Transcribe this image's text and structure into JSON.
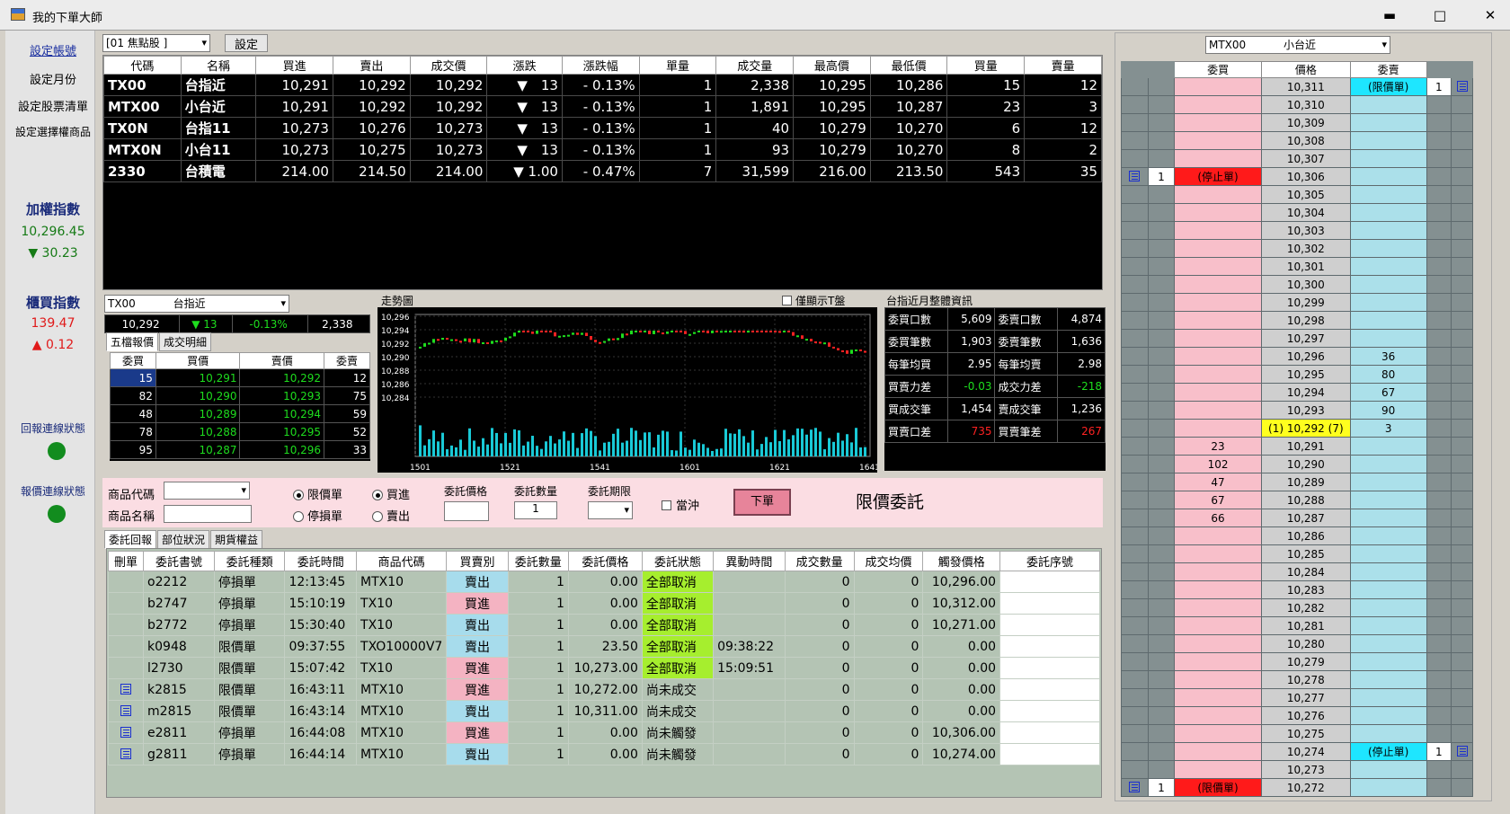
{
  "window": {
    "title": "我的下單大師",
    "minimize": "▬",
    "maximize": "□",
    "close": "✕"
  },
  "nav": {
    "items": [
      "設定帳號",
      "設定月份",
      "設定股票清單",
      "設定選擇權商品"
    ],
    "taiex": {
      "title": "加權指數",
      "value": "10,296.45",
      "change": "▼ 30.23"
    },
    "otc": {
      "title": "櫃買指數",
      "value": "139.47",
      "change": "▲ 0.12"
    },
    "status": [
      "回報連線狀態",
      "報價連線狀態"
    ]
  },
  "quote": {
    "group": "[01 焦點股 ]",
    "settings_btn": "設定",
    "headers": [
      "代碼",
      "名稱",
      "買進",
      "賣出",
      "成交價",
      "漲跌",
      "漲跌幅",
      "單量",
      "成交量",
      "最高價",
      "最低價",
      "買量",
      "賣量"
    ],
    "rows": [
      {
        "code": "TX00",
        "name": "台指近",
        "bid": "10,291",
        "ask": "10,292",
        "last": "10,292",
        "chg": "▼　13",
        "pct": "- 0.13%",
        "qty": "1",
        "vol": "2,338",
        "high": "10,295",
        "low": "10,286",
        "bq": "15",
        "aq": "12"
      },
      {
        "code": "MTX00",
        "name": "小台近",
        "bid": "10,291",
        "ask": "10,292",
        "last": "10,292",
        "chg": "▼　13",
        "pct": "- 0.13%",
        "qty": "1",
        "vol": "1,891",
        "high": "10,295",
        "low": "10,287",
        "bq": "23",
        "aq": "3"
      },
      {
        "code": "TX0N",
        "name": "台指11",
        "bid": "10,273",
        "ask": "10,276",
        "last": "10,273",
        "chg": "▼　13",
        "pct": "- 0.13%",
        "qty": "1",
        "vol": "40",
        "high": "10,279",
        "low": "10,270",
        "bq": "6",
        "aq": "12"
      },
      {
        "code": "MTX0N",
        "name": "小台11",
        "bid": "10,273",
        "ask": "10,275",
        "last": "10,273",
        "chg": "▼　13",
        "pct": "- 0.13%",
        "qty": "1",
        "vol": "93",
        "high": "10,279",
        "low": "10,270",
        "bq": "8",
        "aq": "2"
      },
      {
        "code": "2330",
        "name": "台積電",
        "bid": "214.00",
        "ask": "214.50",
        "last": "214.00",
        "chg": "▼ 1.00",
        "pct": "- 0.47%",
        "qty": "7",
        "vol": "31,599",
        "high": "216.00",
        "low": "213.50",
        "bq": "543",
        "aq": "35"
      }
    ]
  },
  "detail": {
    "symbol": "TX00",
    "name": "台指近",
    "last": "10,292",
    "chg": "▼ 13",
    "pct": "-0.13%",
    "vol": "2,338",
    "tabs": [
      "五檔報價",
      "成交明細"
    ],
    "depth_headers": [
      "委買",
      "買價",
      "賣價",
      "委賣"
    ],
    "depth": [
      [
        "15",
        "10,291",
        "10,292",
        "12"
      ],
      [
        "82",
        "10,290",
        "10,293",
        "75"
      ],
      [
        "48",
        "10,289",
        "10,294",
        "59"
      ],
      [
        "78",
        "10,288",
        "10,295",
        "52"
      ],
      [
        "95",
        "10,287",
        "10,296",
        "33"
      ]
    ]
  },
  "chart": {
    "label": "走勢圖",
    "checkbox": "僅顯示T盤",
    "yticks": [
      "10,296",
      "10,294",
      "10,292",
      "10,290",
      "10,288",
      "10,286",
      "10,284"
    ],
    "xticks": [
      "1501",
      "1521",
      "1541",
      "1601",
      "1621",
      "1641"
    ]
  },
  "stats": {
    "title": "台指近月整體資訊",
    "rows": [
      [
        "委買口數",
        "5,609",
        "委賣口數",
        "4,874"
      ],
      [
        "委買筆數",
        "1,903",
        "委賣筆數",
        "1,636"
      ],
      [
        "每筆均買",
        "2.95",
        "每筆均賣",
        "2.98"
      ],
      [
        "買賣力差",
        "-0.03",
        "成交力差",
        "-218"
      ],
      [
        "買成交筆",
        "1,454",
        "賣成交筆",
        "1,236"
      ],
      [
        "買賣口差",
        "735",
        "買賣筆差",
        "267"
      ]
    ]
  },
  "order": {
    "code_label": "商品代碼",
    "name_label": "商品名稱",
    "limit": "限價單",
    "stop": "停損單",
    "buy": "買進",
    "sell": "賣出",
    "price_label": "委託價格",
    "qty_label": "委託數量",
    "qty_value": "1",
    "tif_label": "委託期限",
    "daytrade": "當沖",
    "submit": "下單",
    "mode_text": "限價委託"
  },
  "orders": {
    "tabs": [
      "委託回報",
      "部位狀況",
      "期貨權益"
    ],
    "headers": [
      "刪單",
      "委託書號",
      "委託種類",
      "委託時間",
      "商品代碼",
      "買賣別",
      "委託數量",
      "委託價格",
      "委託狀態",
      "異動時間",
      "成交數量",
      "成交均價",
      "觸發價格",
      "委託序號"
    ],
    "rows": [
      {
        "del": "",
        "no": "o2212",
        "type": "停損單",
        "time": "12:13:45",
        "code": "MTX10",
        "side": "賣出",
        "qty": "1",
        "price": "0.00",
        "status": "全部取消",
        "mtime": "",
        "fqty": "0",
        "favg": "0",
        "trig": "10,296.00"
      },
      {
        "del": "",
        "no": "b2747",
        "type": "停損單",
        "time": "15:10:19",
        "code": "TX10",
        "side": "買進",
        "qty": "1",
        "price": "0.00",
        "status": "全部取消",
        "mtime": "",
        "fqty": "0",
        "favg": "0",
        "trig": "10,312.00"
      },
      {
        "del": "",
        "no": "b2772",
        "type": "停損單",
        "time": "15:30:40",
        "code": "TX10",
        "side": "賣出",
        "qty": "1",
        "price": "0.00",
        "status": "全部取消",
        "mtime": "",
        "fqty": "0",
        "favg": "0",
        "trig": "10,271.00"
      },
      {
        "del": "",
        "no": "k0948",
        "type": "限價單",
        "time": "09:37:55",
        "code": "TXO10000V7",
        "side": "賣出",
        "qty": "1",
        "price": "23.50",
        "status": "全部取消",
        "mtime": "09:38:22",
        "fqty": "0",
        "favg": "0",
        "trig": "0.00"
      },
      {
        "del": "",
        "no": "l2730",
        "type": "限價單",
        "time": "15:07:42",
        "code": "TX10",
        "side": "買進",
        "qty": "1",
        "price": "10,273.00",
        "status": "全部取消",
        "mtime": "15:09:51",
        "fqty": "0",
        "favg": "0",
        "trig": "0.00"
      },
      {
        "del": "icon",
        "no": "k2815",
        "type": "限價單",
        "time": "16:43:11",
        "code": "MTX10",
        "side": "買進",
        "qty": "1",
        "price": "10,272.00",
        "status": "尚未成交",
        "mtime": "",
        "fqty": "0",
        "favg": "0",
        "trig": "0.00"
      },
      {
        "del": "icon",
        "no": "m2815",
        "type": "限價單",
        "time": "16:43:14",
        "code": "MTX10",
        "side": "賣出",
        "qty": "1",
        "price": "10,311.00",
        "status": "尚未成交",
        "mtime": "",
        "fqty": "0",
        "favg": "0",
        "trig": "0.00"
      },
      {
        "del": "icon",
        "no": "e2811",
        "type": "停損單",
        "time": "16:44:08",
        "code": "MTX10",
        "side": "買進",
        "qty": "1",
        "price": "0.00",
        "status": "尚未觸發",
        "mtime": "",
        "fqty": "0",
        "favg": "0",
        "trig": "10,306.00"
      },
      {
        "del": "icon",
        "no": "g2811",
        "type": "停損單",
        "time": "16:44:14",
        "code": "MTX10",
        "side": "賣出",
        "qty": "1",
        "price": "0.00",
        "status": "尚未觸發",
        "mtime": "",
        "fqty": "0",
        "favg": "0",
        "trig": "10,274.00"
      }
    ]
  },
  "ladder": {
    "symbol": "MTX00",
    "name": "小台近",
    "headers": [
      "委買",
      "價格",
      "委賣"
    ],
    "rows": [
      {
        "price": "10,311",
        "bid": "",
        "ask": "(限價單)",
        "askflag": "cyan",
        "rq": "1",
        "ricon": true
      },
      {
        "price": "10,310"
      },
      {
        "price": "10,309"
      },
      {
        "price": "10,308"
      },
      {
        "price": "10,307"
      },
      {
        "price": "10,306",
        "bid": "(停止單)",
        "bidflag": "red",
        "lq": "1",
        "licon": true
      },
      {
        "price": "10,305"
      },
      {
        "price": "10,304"
      },
      {
        "price": "10,303"
      },
      {
        "price": "10,302"
      },
      {
        "price": "10,301"
      },
      {
        "price": "10,300"
      },
      {
        "price": "10,299"
      },
      {
        "price": "10,298"
      },
      {
        "price": "10,297"
      },
      {
        "price": "10,296",
        "ask": "36"
      },
      {
        "price": "10,295",
        "ask": "80"
      },
      {
        "price": "10,294",
        "ask": "67"
      },
      {
        "price": "10,293",
        "ask": "90"
      },
      {
        "price": "(1) 10,292 (7)",
        "ask": "3",
        "pflag": "yellow"
      },
      {
        "price": "10,291",
        "bid": "23"
      },
      {
        "price": "10,290",
        "bid": "102"
      },
      {
        "price": "10,289",
        "bid": "47"
      },
      {
        "price": "10,288",
        "bid": "67"
      },
      {
        "price": "10,287",
        "bid": "66"
      },
      {
        "price": "10,286"
      },
      {
        "price": "10,285"
      },
      {
        "price": "10,284"
      },
      {
        "price": "10,283"
      },
      {
        "price": "10,282"
      },
      {
        "price": "10,281"
      },
      {
        "price": "10,280"
      },
      {
        "price": "10,279"
      },
      {
        "price": "10,278"
      },
      {
        "price": "10,277"
      },
      {
        "price": "10,276"
      },
      {
        "price": "10,275"
      },
      {
        "price": "10,274",
        "ask": "(停止單)",
        "askflag": "cyan",
        "rq": "1",
        "ricon": true
      },
      {
        "price": "10,273"
      },
      {
        "price": "10,272",
        "bid": "(限價單)",
        "bidflag": "red",
        "lq": "1",
        "licon": true
      }
    ]
  },
  "colors": {
    "up": "#ff2222",
    "down": "#1edd1e",
    "buy": "#f4b3c2",
    "sell": "#a7dcec",
    "cancel": "#a6ee2e"
  }
}
